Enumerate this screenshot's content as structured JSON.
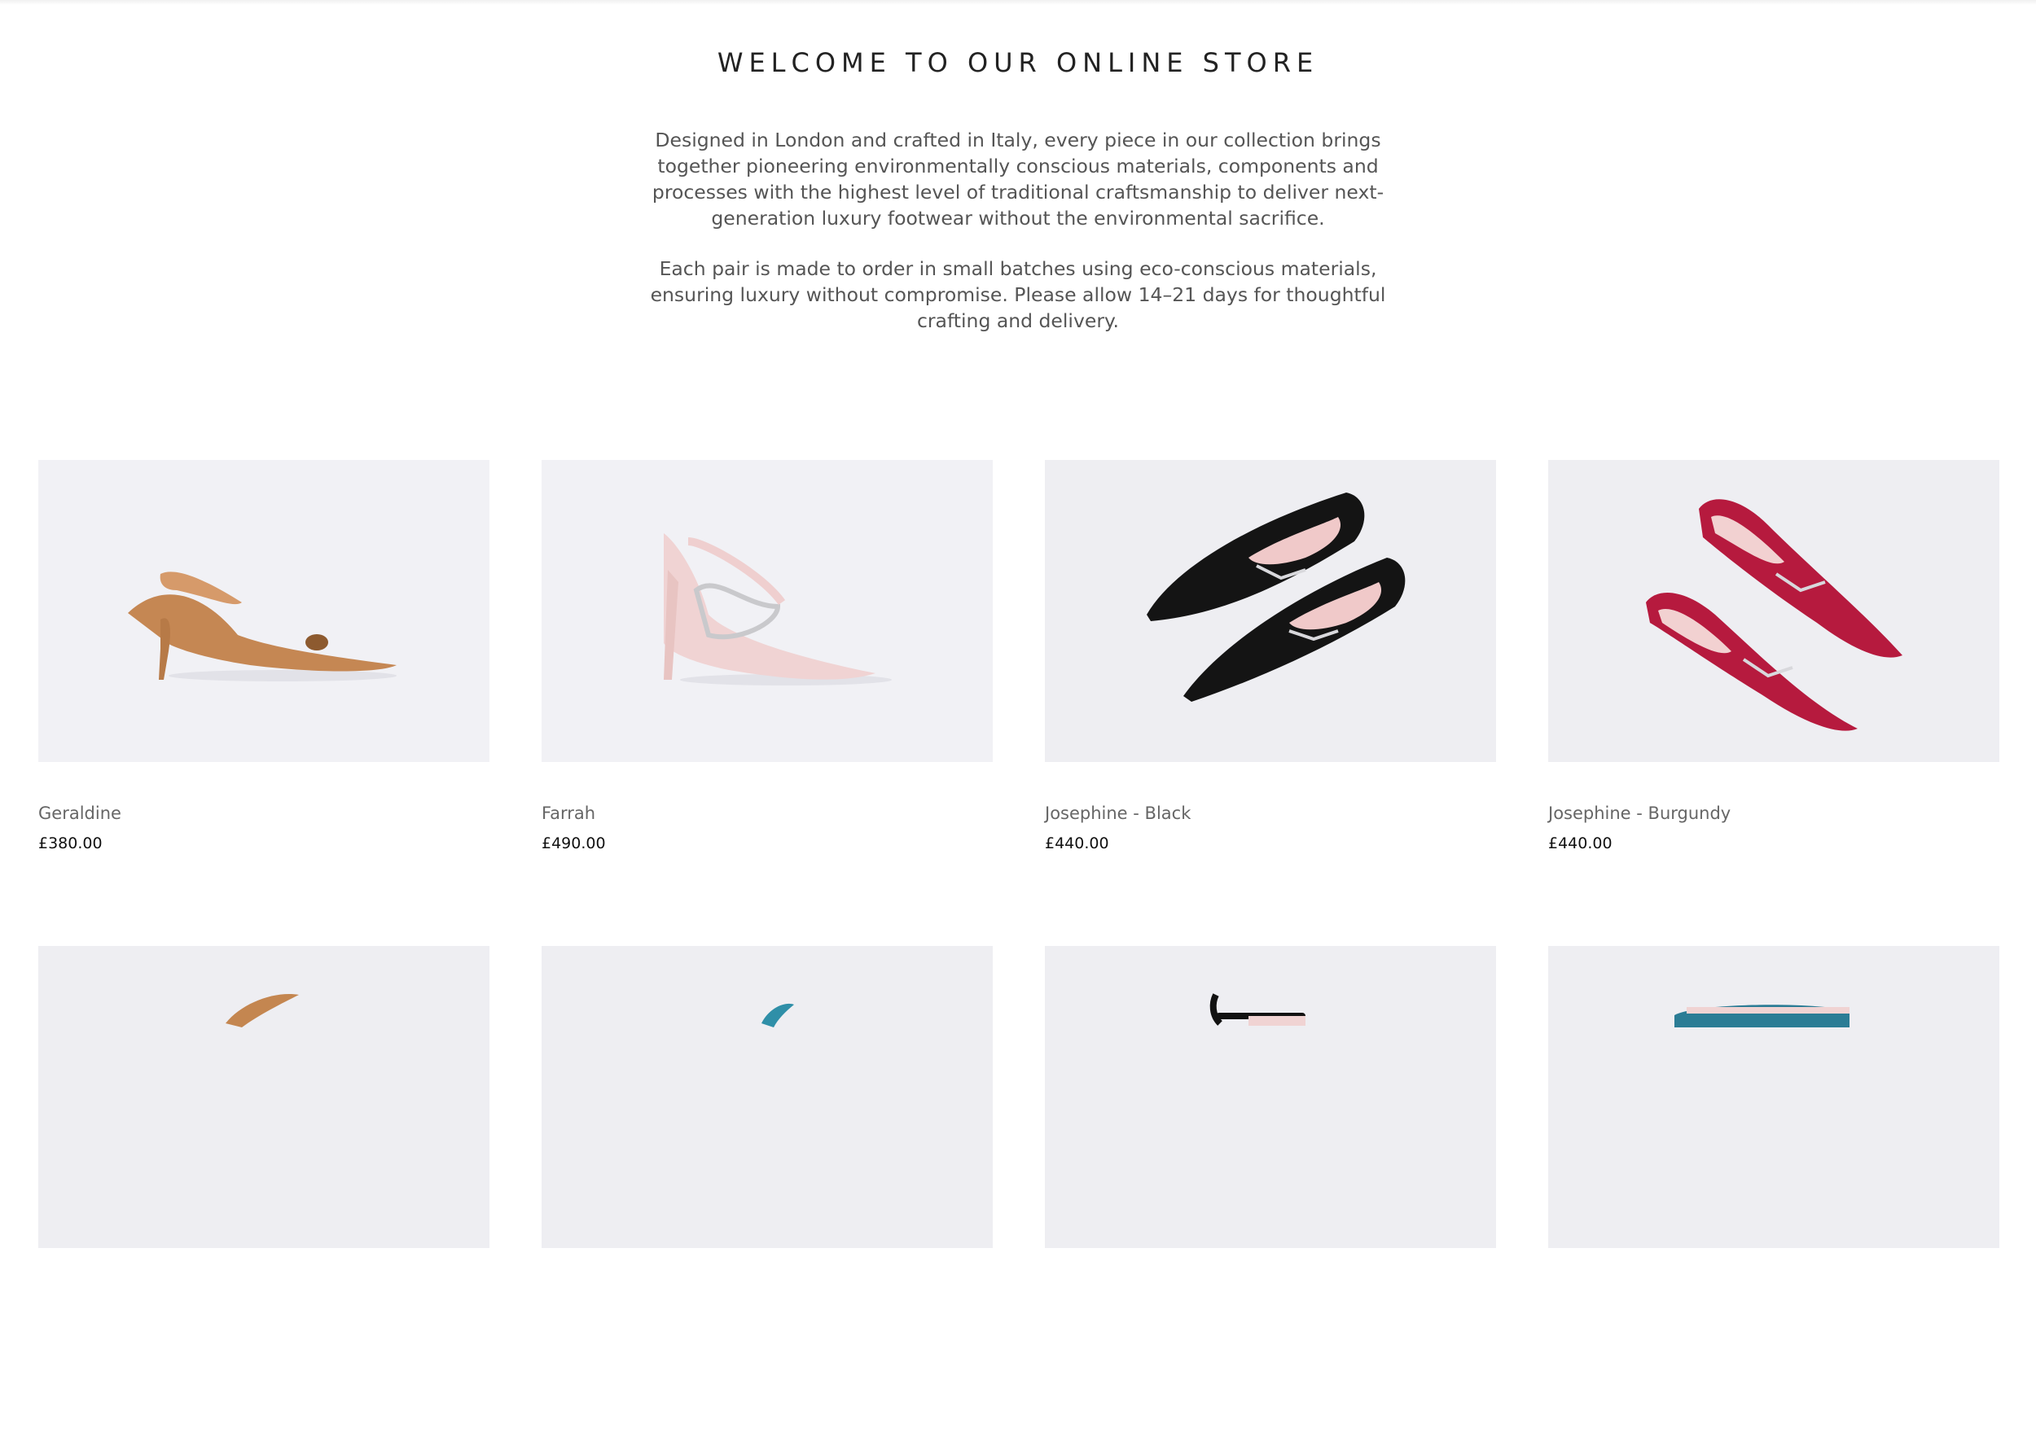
{
  "intro": {
    "title": "WELCOME TO OUR ONLINE STORE",
    "paragraph_1": "Designed in London and crafted in Italy, every piece in our collection brings together pioneering environmentally conscious materials, components and processes with the highest level of traditional craftsmanship to deliver next-generation luxury footwear without the environmental sacrifice.",
    "paragraph_2": "Each pair is made to order in small batches using eco-conscious materials, ensuring luxury without compromise. Please allow 14–21 days for thoughtful crafting and delivery."
  },
  "products": [
    {
      "name": "Geraldine",
      "price": "£380.00",
      "image": "tan-slingback-heel-image",
      "color": "#c48650"
    },
    {
      "name": "Farrah",
      "price": "£490.00",
      "image": "pink-crystal-stiletto-image",
      "color": "#edd0cf"
    },
    {
      "name": "Josephine - Black",
      "price": "£440.00",
      "image": "black-crystal-flats-image",
      "color": "#121212"
    },
    {
      "name": "Josephine - Burgundy",
      "price": "£440.00",
      "image": "burgundy-crystal-flats-image",
      "color": "#b3173b"
    },
    {
      "name": "",
      "price": "",
      "image": "tan-heel-image-partial",
      "color": "#c48650"
    },
    {
      "name": "",
      "price": "",
      "image": "teal-shoe-image-partial",
      "color": "#2f8fa8"
    },
    {
      "name": "",
      "price": "",
      "image": "black-strap-shoe-image-partial",
      "color": "#121212"
    },
    {
      "name": "",
      "price": "",
      "image": "teal-flat-image-partial",
      "color": "#2b7c95"
    }
  ]
}
